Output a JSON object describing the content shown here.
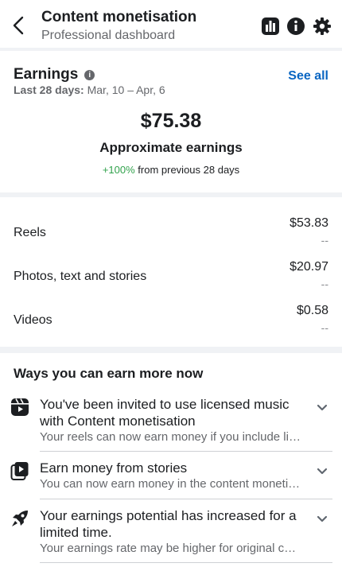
{
  "header": {
    "title": "Content monetisation",
    "subtitle": "Professional dashboard",
    "icons": [
      "back-arrow-icon",
      "bar-chart-icon",
      "info-icon",
      "gear-icon"
    ]
  },
  "earnings": {
    "title": "Earnings",
    "period_label": "Last 28 days:",
    "period_range": "Mar, 10 – Apr, 6",
    "see_all": "See all",
    "amount": "$75.38",
    "amount_label": "Approximate earnings",
    "change_pct": "+100%",
    "change_text": "from previous 28 days"
  },
  "breakdown": [
    {
      "label": "Reels",
      "value": "$53.83",
      "sub": "--"
    },
    {
      "label": "Photos, text and stories",
      "value": "$20.97",
      "sub": "--"
    },
    {
      "label": "Videos",
      "value": "$0.58",
      "sub": "--"
    }
  ],
  "ways": {
    "title": "Ways you can earn more now",
    "items": [
      {
        "icon": "reels-clapper-icon",
        "title": "You've been invited to use licensed music with Content monetisation",
        "desc": "Your reels can now earn money if you include licensed music"
      },
      {
        "icon": "stories-play-icon",
        "title": "Earn money from stories",
        "desc": "You can now earn money in the content monetisation program"
      },
      {
        "icon": "rocket-icon",
        "title": "Your earnings potential has increased for a limited time.",
        "desc": "Your earnings rate may be higher for original content"
      }
    ]
  },
  "colors": {
    "link": "#0a66c2",
    "positive": "#31a24c",
    "secondary_text": "#65676b",
    "background": "#f0f2f5"
  }
}
